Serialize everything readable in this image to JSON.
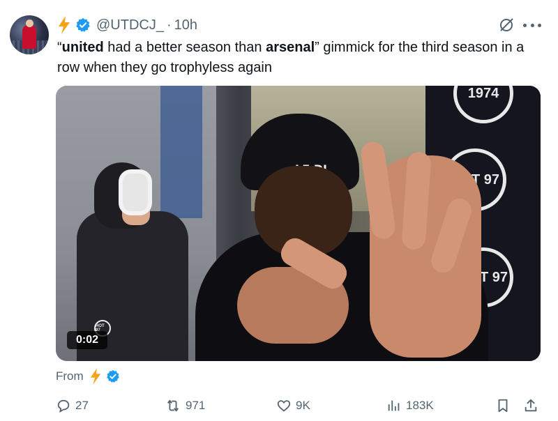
{
  "tweet": {
    "handle": "@UTDCJ_",
    "separator": "·",
    "time_ago": "10h",
    "text_parts": {
      "quote_open": "“",
      "bold1": "united",
      "mid1": " had a better season than ",
      "bold2": "arsenal",
      "rest": "” gimmick for the third season in a row when they go trophyless again"
    }
  },
  "media": {
    "duration": "0:02",
    "logo_small": "HOT 97",
    "banner_logos": [
      "1974",
      "HOT 97",
      "HOT 97"
    ],
    "beanie_text": "LE DJ"
  },
  "source": {
    "from_label": "From"
  },
  "actions": {
    "replies": "27",
    "reposts": "971",
    "likes": "9K",
    "views": "183K"
  },
  "colors": {
    "text": "#0f1419",
    "secondary": "#536471",
    "verified_blue": "#1d9bf0",
    "bolt_orange": "#f7a21b"
  },
  "icons": [
    "avatar",
    "lightning-bolt-icon",
    "verified-badge-icon",
    "grok-icon",
    "more-icon",
    "reply-icon",
    "repost-icon",
    "like-icon",
    "views-icon",
    "bookmark-icon",
    "share-icon"
  ]
}
